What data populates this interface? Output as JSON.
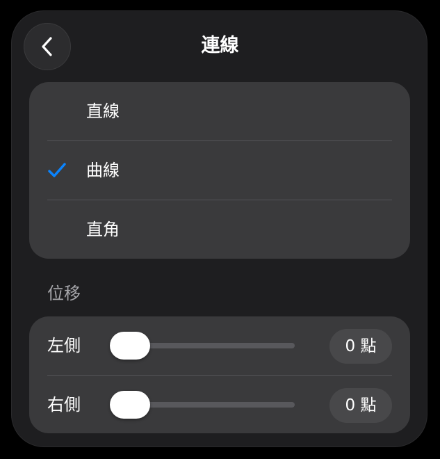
{
  "header": {
    "title": "連線",
    "back_icon": "chevron-left-icon"
  },
  "connection_types": [
    {
      "label": "直線",
      "selected": false
    },
    {
      "label": "曲線",
      "selected": true
    },
    {
      "label": "直角",
      "selected": false
    }
  ],
  "offset": {
    "header": "位移",
    "rows": [
      {
        "label": "左側",
        "value": 0,
        "value_text": "0 點"
      },
      {
        "label": "右側",
        "value": 0,
        "value_text": "0 點"
      }
    ]
  },
  "colors": {
    "accent": "#0a84ff",
    "panel": "#1e1e20",
    "group": "#3a3a3c"
  }
}
